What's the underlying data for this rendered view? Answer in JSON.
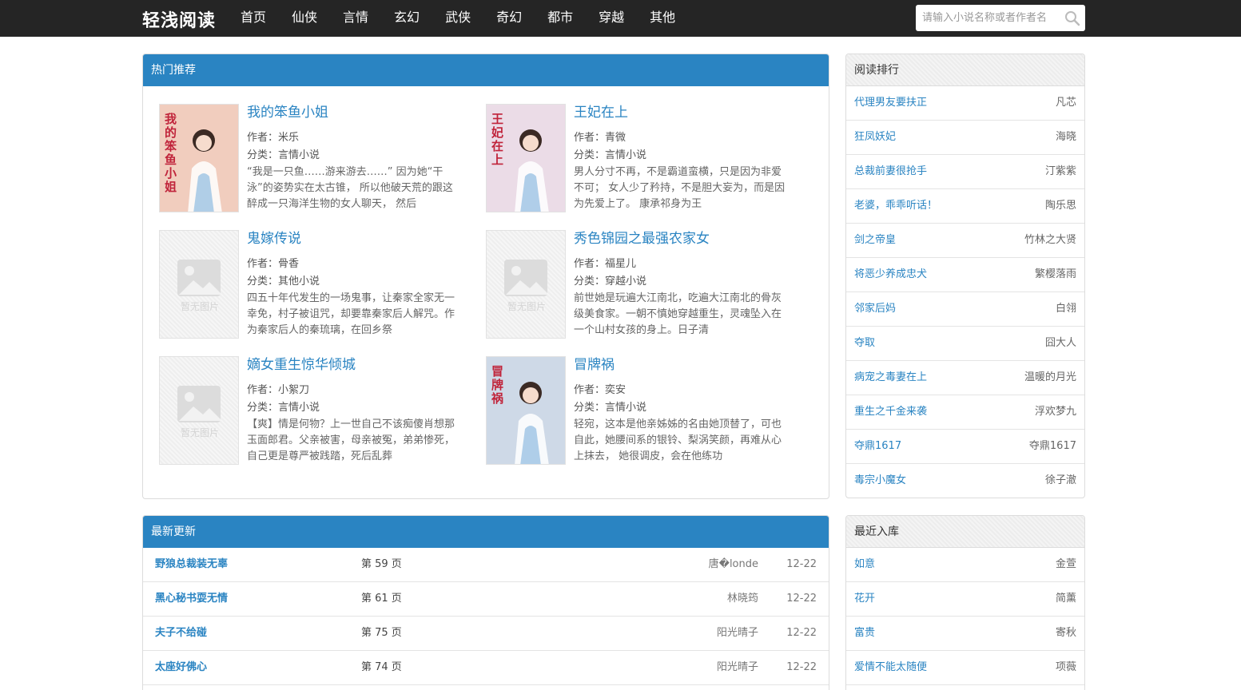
{
  "brand": "轻浅阅读",
  "nav": [
    "首页",
    "仙侠",
    "言情",
    "玄幻",
    "武侠",
    "奇幻",
    "都市",
    "穿越",
    "其他"
  ],
  "search": {
    "placeholder": "请输入小说名称或者作者名"
  },
  "hot": {
    "title": "热门推荐",
    "author_label": "作者：",
    "category_label": "分类：",
    "books": [
      {
        "title": "我的笨鱼小姐",
        "author": "米乐",
        "category": "言情小说",
        "desc": "“我是一只鱼……游来游去……” 因为她“干泳”的姿势实在太古锥， 所以他破天荒的跟这醉成一只海洋生物的女人聊天， 然后",
        "cover_text": "我的笨鱼小姐",
        "cover_color": "#f0c9b8",
        "has_cover": true
      },
      {
        "title": "王妃在上",
        "author": "青微",
        "category": "言情小说",
        "desc": "男人分寸不再，不是霸道蛮横，只是因为非爱不可； 女人少了矜持，不是胆大妄为，而是因为先爱上了。 康承祁身为王",
        "cover_text": "王妃在上",
        "cover_color": "#e9d9e6",
        "has_cover": true
      },
      {
        "title": "鬼嫁传说",
        "author": "骨香",
        "category": "其他小说",
        "desc": "四五十年代发生的一场鬼事，让秦家全家无一幸免，村子被诅咒，却要靠秦家后人解咒。作为秦家后人的秦琉璃，在回乡祭",
        "cover_text": "暂无图片",
        "has_cover": false
      },
      {
        "title": "秀色锦园之最强农家女",
        "author": "福星儿",
        "category": "穿越小说",
        "desc": "前世她是玩遍大江南北，吃遍大江南北的骨灰级美食家。一朝不慎她穿越重生，灵魂坠入在一个山村女孩的身上。日子清",
        "cover_text": "暂无图片",
        "has_cover": false
      },
      {
        "title": "嫡女重生惊华倾城",
        "author": "小絮刀",
        "category": "言情小说",
        "desc": "【爽】情是何物？上一世自己不该痴傻肖想那玉面郎君。父亲被害，母亲被冤，弟弟惨死，自己更是尊严被践踏，死后乱葬",
        "cover_text": "暂无图片",
        "has_cover": false
      },
      {
        "title": "冒牌祸",
        "author": "奕安",
        "category": "言情小说",
        "desc": "轻宛，这本是他亲姊姊的名由她顶替了，可也自此，她腰间系的银铃、梨涡笑颜，再难从心上抹去， 她很调皮，会在他练功",
        "cover_text": "冒牌祸",
        "cover_color": "#c9d6e6",
        "has_cover": true
      }
    ]
  },
  "latest": {
    "title": "最新更新",
    "rows": [
      {
        "title": "野狼总裁装无辜",
        "chapter": "第 59 页",
        "author": "唐�londe",
        "date": "12-22"
      },
      {
        "title": "黑心秘书耍无情",
        "chapter": "第 61 页",
        "author": "林晓筠",
        "date": "12-22"
      },
      {
        "title": "夫子不给碰",
        "chapter": "第 75 页",
        "author": "阳光晴子",
        "date": "12-22"
      },
      {
        "title": "太座好佛心",
        "chapter": "第 74 页",
        "author": "阳光晴子",
        "date": "12-22"
      }
    ]
  },
  "rank": {
    "title": "阅读排行",
    "rows": [
      {
        "name": "代理男友要扶正",
        "author": "凡芯"
      },
      {
        "name": "狂凤妖妃",
        "author": "海晓"
      },
      {
        "name": "总裁前妻很抢手",
        "author": "汀紫紫"
      },
      {
        "name": "老婆，乖乖听话！",
        "author": "陶乐思"
      },
      {
        "name": "剑之帝皇",
        "author": "竹林之大贤"
      },
      {
        "name": "将恶少养成忠犬",
        "author": "繁樱落雨"
      },
      {
        "name": "邻家后妈",
        "author": "白翎"
      },
      {
        "name": "夺取",
        "author": "囧大人"
      },
      {
        "name": "病宠之毒妻在上",
        "author": "温暖的月光"
      },
      {
        "name": "重生之千金来袭",
        "author": "浮欢梦九"
      },
      {
        "name": "夺鼎1617",
        "author": "夺鼎1617"
      },
      {
        "name": "毒宗小魔女",
        "author": "徐子澈"
      }
    ]
  },
  "recent": {
    "title": "最近入库",
    "rows": [
      {
        "name": "如意",
        "author": "金萱"
      },
      {
        "name": "花开",
        "author": "简薰"
      },
      {
        "name": "富贵",
        "author": "寄秋"
      },
      {
        "name": "爱情不能太随便",
        "author": "项薇"
      }
    ]
  }
}
